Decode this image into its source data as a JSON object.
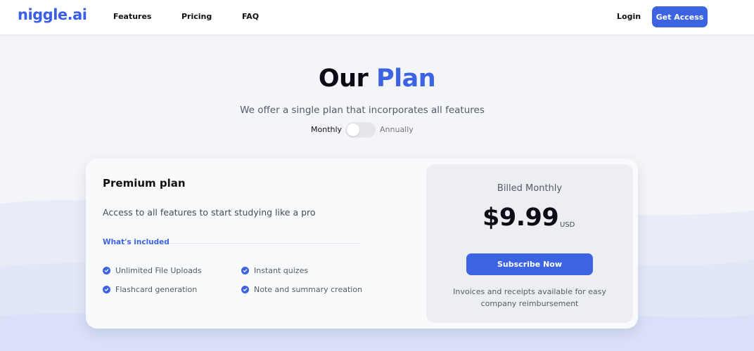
{
  "brand": {
    "logo": "niggle.ai",
    "accent": "#3c63e2"
  },
  "nav": {
    "links": [
      "Features",
      "Pricing",
      "FAQ"
    ],
    "login": "Login",
    "cta": "Get Access"
  },
  "hero": {
    "title_main": "Our",
    "title_accent": "Plan",
    "subtitle": "We offer a single plan that incorporates all features",
    "toggle": {
      "left_label": "Monthly",
      "right_label": "Annually",
      "state": "monthly"
    }
  },
  "plan": {
    "name": "Premium plan",
    "description": "Access to all features to start studying like a pro",
    "included_heading": "What's included",
    "features": [
      "Unlimited File Uploads",
      "Instant quizes",
      "Flashcard generation",
      "Note and summary creation"
    ],
    "check_icon": "check-circle-icon"
  },
  "pricing": {
    "billed": "Billed Monthly",
    "price": "$9.99",
    "currency": "USD",
    "subscribe": "Subscribe Now",
    "note": "Invoices and receipts available for easy company reimbursement"
  }
}
